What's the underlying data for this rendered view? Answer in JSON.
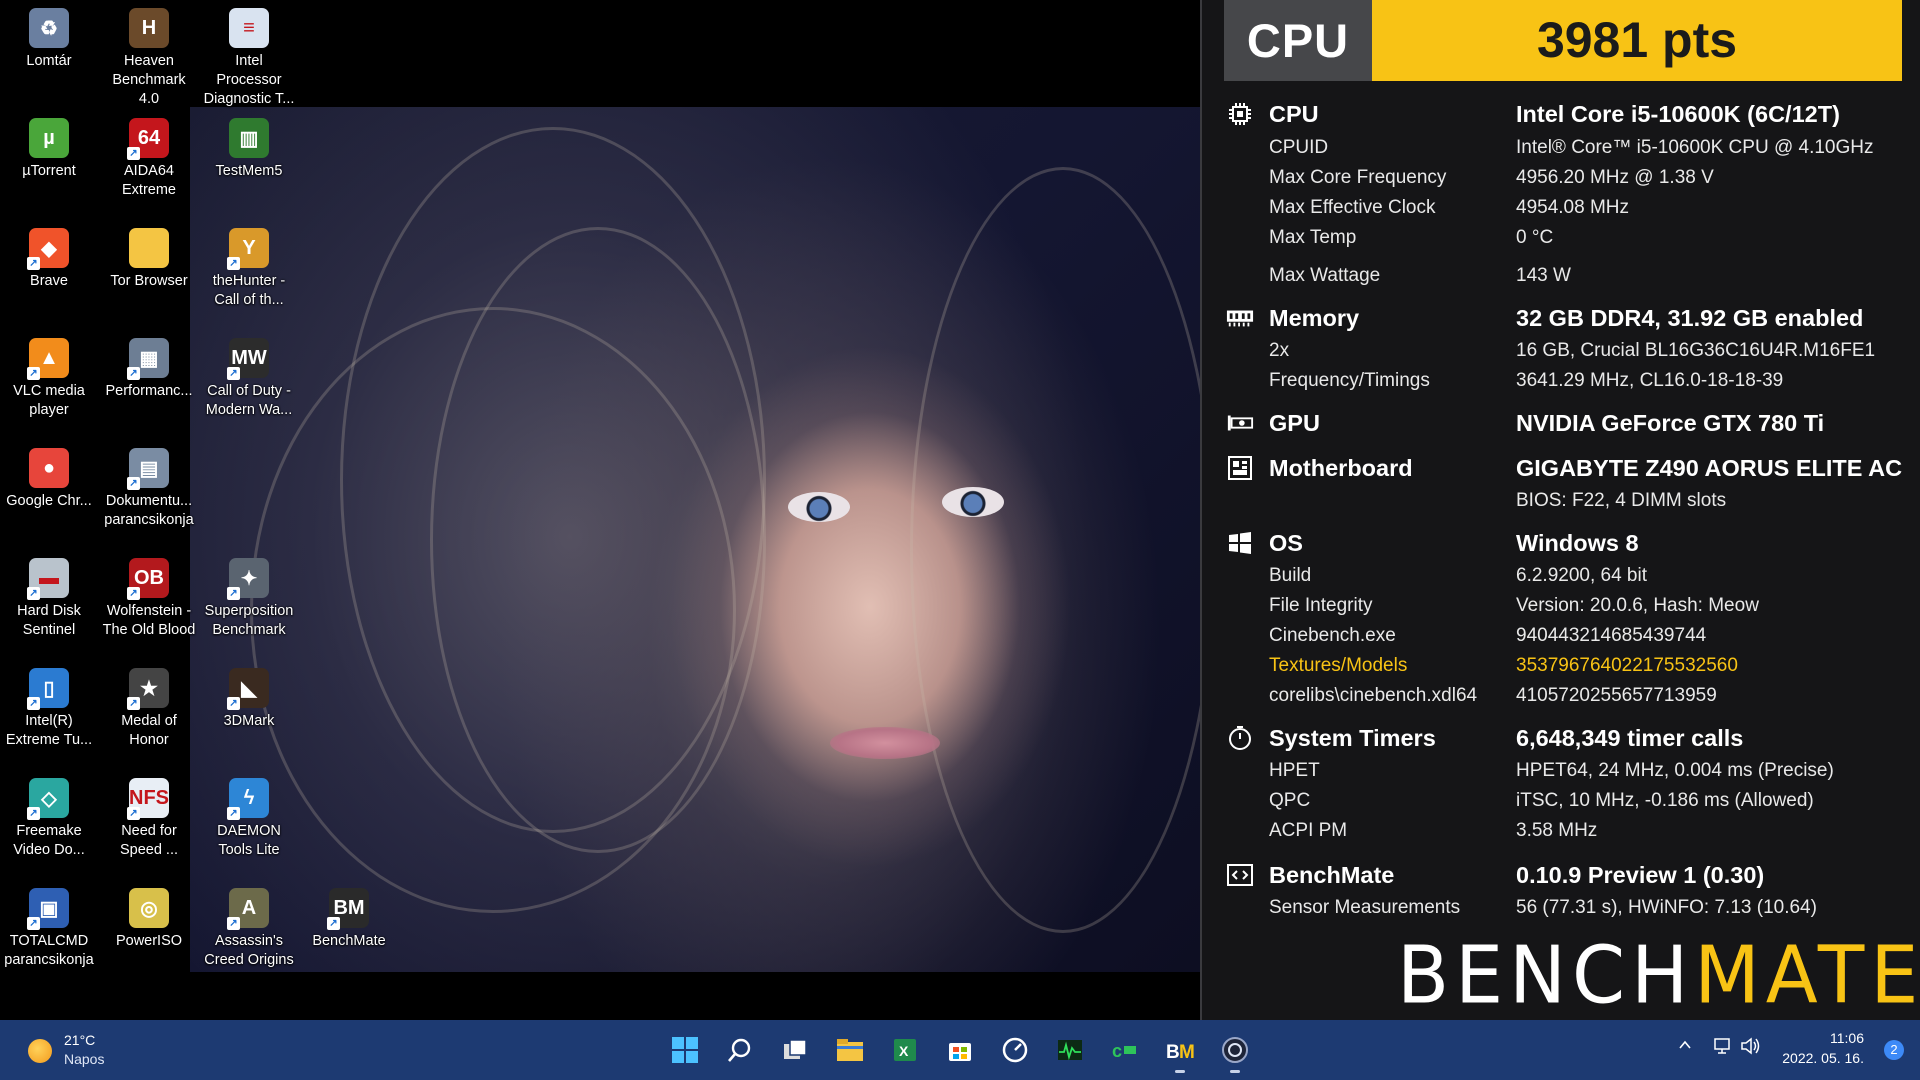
{
  "desktop": {
    "icons": [
      {
        "label": "Lomtár",
        "icon": "recycle-bin-icon",
        "color": "#6a7fa0",
        "glyph": "♻",
        "shortcut": false
      },
      {
        "label": "Heaven Benchmark 4.0",
        "icon": "heaven-benchmark-icon",
        "color": "#6b4a2a",
        "glyph": "H",
        "shortcut": false
      },
      {
        "label": "Intel Processor Diagnostic T...",
        "icon": "document-icon",
        "color": "#d9e3f0",
        "glyph": "≡",
        "shortcut": false
      },
      {
        "label": "µTorrent",
        "icon": "utorrent-icon",
        "color": "#4aa63a",
        "glyph": "µ",
        "shortcut": false
      },
      {
        "label": "AIDA64 Extreme",
        "icon": "aida64-icon",
        "color": "#c4161c",
        "glyph": "64",
        "shortcut": true
      },
      {
        "label": "TestMem5",
        "icon": "memory-chip-icon",
        "color": "#2f7a2f",
        "glyph": "▥",
        "shortcut": false
      },
      {
        "label": "Brave",
        "icon": "brave-icon",
        "color": "#f0532a",
        "glyph": "◆",
        "shortcut": true
      },
      {
        "label": "Tor Browser",
        "icon": "folder-icon",
        "color": "#f4c543",
        "glyph": "",
        "shortcut": false
      },
      {
        "label": "theHunter - Call of th...",
        "icon": "thehunter-icon",
        "color": "#d9992a",
        "glyph": "Y",
        "shortcut": true
      },
      {
        "label": "VLC media player",
        "icon": "vlc-icon",
        "color": "#f28c1b",
        "glyph": "▲",
        "shortcut": true
      },
      {
        "label": "Performanc...",
        "icon": "performance-icon",
        "color": "#6d7e94",
        "glyph": "▦",
        "shortcut": true
      },
      {
        "label": "Call of Duty - Modern Wa...",
        "icon": "call-of-duty-icon",
        "color": "#2c2c2c",
        "glyph": "MW",
        "shortcut": true
      },
      {
        "label": "Google Chr...",
        "icon": "chrome-icon",
        "color": "#e7453b",
        "glyph": "●",
        "shortcut": false
      },
      {
        "label": "Dokumentu... parancsikonja",
        "icon": "document-shortcut-icon",
        "color": "#7a8ca3",
        "glyph": "▤",
        "shortcut": true
      },
      {
        "label": "Hard Disk Sentinel",
        "icon": "hard-disk-sentinel-icon",
        "color": "#b9c3cc",
        "glyph": "▬",
        "shortcut": true
      },
      {
        "label": "Wolfenstein - The Old Blood",
        "icon": "wolfenstein-icon",
        "color": "#b3191d",
        "glyph": "OB",
        "shortcut": true
      },
      {
        "label": "Superposition Benchmark",
        "icon": "superposition-icon",
        "color": "#5a6470",
        "glyph": "✦",
        "shortcut": true
      },
      {
        "label": "Intel(R) Extreme Tu...",
        "icon": "intel-xtu-icon",
        "color": "#2b7bd1",
        "glyph": "▯",
        "shortcut": true
      },
      {
        "label": "Medal of Honor",
        "icon": "medal-of-honor-icon",
        "color": "#444",
        "glyph": "★",
        "shortcut": true
      },
      {
        "label": "3DMark",
        "icon": "3dmark-icon",
        "color": "#3a2a20",
        "glyph": "◣",
        "shortcut": true
      },
      {
        "label": "Freemake Video Do...",
        "icon": "freemake-icon",
        "color": "#2aa7a0",
        "glyph": "◇",
        "shortcut": true
      },
      {
        "label": "Need for Speed ...",
        "icon": "need-for-speed-icon",
        "color": "#e8eef5",
        "glyph": "NFS",
        "shortcut": true
      },
      {
        "label": "DAEMON Tools Lite",
        "icon": "daemon-tools-icon",
        "color": "#2d86d6",
        "glyph": "ϟ",
        "shortcut": true
      },
      {
        "label": "TOTALCMD parancsikonja",
        "icon": "floppy-icon",
        "color": "#2e5fb3",
        "glyph": "▣",
        "shortcut": true
      },
      {
        "label": "PowerISO",
        "icon": "poweriso-icon",
        "color": "#d8c04a",
        "glyph": "◎",
        "shortcut": false
      },
      {
        "label": "Assassin's Creed Origins",
        "icon": "assassins-creed-icon",
        "color": "#6c6a4a",
        "glyph": "A",
        "shortcut": true
      },
      {
        "label": "BenchMate",
        "icon": "benchmate-icon",
        "color": "#2a2a2a",
        "glyph": "BM",
        "shortcut": true
      }
    ]
  },
  "benchmate": {
    "header": {
      "label": "CPU",
      "score": "3981 pts"
    },
    "rows": [
      {
        "type": "head",
        "icon": "cpu-chip-icon",
        "key": "CPU",
        "value": "Intel Core i5-10600K (6C/12T)"
      },
      {
        "type": "row",
        "key": "CPUID",
        "value": "Intel® Core™ i5-10600K CPU @ 4.10GHz"
      },
      {
        "type": "row",
        "key": "Max Core Frequency",
        "value": "4956.20 MHz @ 1.38 V"
      },
      {
        "type": "row",
        "key": "Max Effective Clock",
        "value": "4954.08 MHz"
      },
      {
        "type": "row",
        "key": "Max Temp",
        "value": "0 °C"
      },
      {
        "type": "row",
        "key": "Max Wattage",
        "value": "143 W"
      },
      {
        "type": "head",
        "icon": "memory-icon",
        "key": "Memory",
        "value": "32 GB DDR4, 31.92 GB enabled"
      },
      {
        "type": "row",
        "key": "2x",
        "value": "16 GB, Crucial BL16G36C16U4R.M16FE1"
      },
      {
        "type": "row",
        "key": "Frequency/Timings",
        "value": "3641.29 MHz, CL16.0-18-18-39"
      },
      {
        "type": "head",
        "icon": "gpu-icon",
        "key": "GPU",
        "value": "NVIDIA GeForce GTX 780 Ti"
      },
      {
        "type": "head",
        "icon": "motherboard-icon",
        "key": "Motherboard",
        "value": "GIGABYTE Z490 AORUS ELITE AC"
      },
      {
        "type": "row",
        "key": "",
        "value": "BIOS: F22, 4 DIMM slots"
      },
      {
        "type": "head",
        "icon": "windows-icon",
        "key": "OS",
        "value": "Windows 8"
      },
      {
        "type": "row",
        "key": "Build",
        "value": "6.2.9200, 64 bit"
      },
      {
        "type": "row",
        "key": "File Integrity",
        "value": "Version: 20.0.6, Hash: Meow"
      },
      {
        "type": "row",
        "key": "Cinebench.exe",
        "value": "940443214685439744"
      },
      {
        "type": "hl",
        "key": "Textures/Models",
        "value": "3537967640221755325​60"
      },
      {
        "type": "row",
        "key": "corelibs\\cinebench.xdl64",
        "value": "4105720255657713959"
      },
      {
        "type": "head",
        "icon": "stopwatch-icon",
        "key": "System Timers",
        "value": "6,648,349 timer calls"
      },
      {
        "type": "row",
        "key": "HPET",
        "value": "HPET64, 24 MHz, 0.004 ms (Precise)"
      },
      {
        "type": "row",
        "key": "QPC",
        "value": "iTSC, 10 MHz, -0.186 ms (Allowed)"
      },
      {
        "type": "row",
        "key": "ACPI PM",
        "value": "3.58 MHz"
      },
      {
        "type": "head",
        "icon": "code-icon",
        "key": "BenchMate",
        "value": "0.10.9 Preview 1 (0.30)"
      },
      {
        "type": "row",
        "key": "Sensor Measurements",
        "value": "56 (77.31 s), HWiNFO: 7.13 (10.64)"
      }
    ],
    "logo": {
      "part1": "BENCH",
      "part2": "MATE"
    }
  },
  "taskbar": {
    "weather": {
      "temp": "21°C",
      "desc": "Napos"
    },
    "apps": [
      {
        "name": "start-button",
        "color": "#4cc2ff"
      },
      {
        "name": "search-button",
        "color": "#ffffff"
      },
      {
        "name": "task-view-button",
        "color": "#ffffff"
      },
      {
        "name": "file-explorer-button",
        "color": "#f4c543"
      },
      {
        "name": "excel-button",
        "color": "#1f8a4c"
      },
      {
        "name": "store-button",
        "color": "#ffffff"
      },
      {
        "name": "speedometer-app-button",
        "color": "#ffffff"
      },
      {
        "name": "monitor-app-button",
        "color": "#1fae4a"
      },
      {
        "name": "cpuz-app-button",
        "color": "#2ec45a"
      },
      {
        "name": "benchmate-taskbar-button",
        "color": "#f8c315"
      },
      {
        "name": "cinebench-taskbar-button",
        "color": "#9aa7c8"
      }
    ],
    "clock": {
      "time": "11:06",
      "date": "2022. 05. 16."
    },
    "notifications": "2"
  }
}
